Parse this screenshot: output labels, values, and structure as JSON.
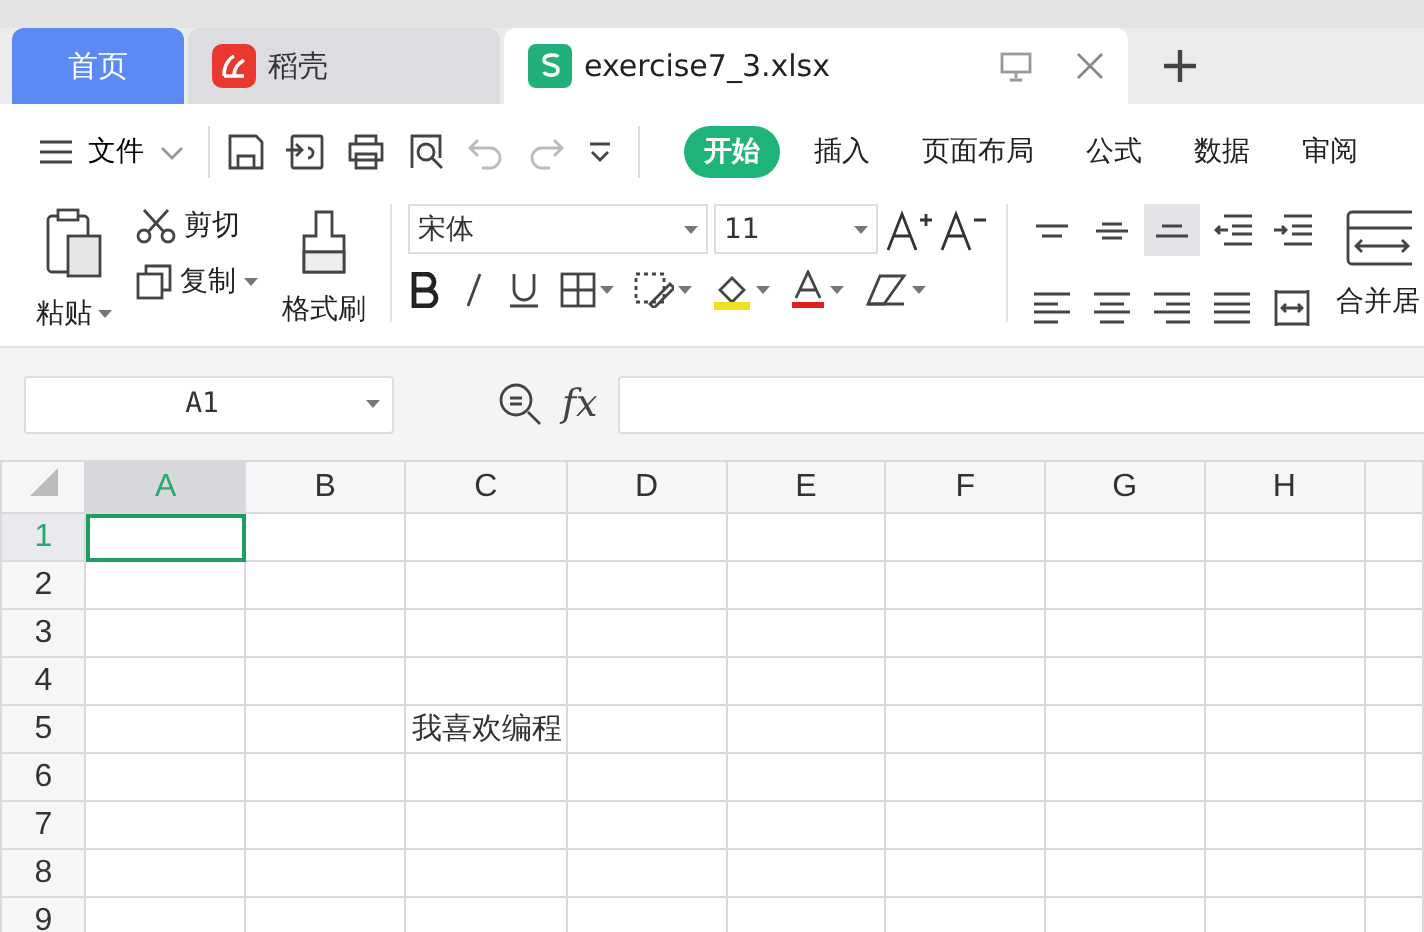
{
  "tabs": [
    {
      "label": "首页",
      "kind": "home",
      "selected": false
    },
    {
      "label": "稻壳",
      "kind": "docer",
      "selected": false
    },
    {
      "label": "exercise7_3.xlsx",
      "kind": "sheet",
      "selected": true
    }
  ],
  "toolbar": {
    "file_menu": "文件",
    "ribbon_tabs": [
      {
        "label": "开始",
        "selected": true
      },
      {
        "label": "插入",
        "selected": false
      },
      {
        "label": "页面布局",
        "selected": false
      },
      {
        "label": "公式",
        "selected": false
      },
      {
        "label": "数据",
        "selected": false
      },
      {
        "label": "审阅",
        "selected": false
      }
    ]
  },
  "ribbon": {
    "paste": "粘贴",
    "cut": "剪切",
    "copy": "复制",
    "format_painter": "格式刷",
    "font": "宋体",
    "font_size": "11",
    "merge": "合并居",
    "alignments": [
      {
        "kind": "top",
        "selected": false
      },
      {
        "kind": "middle",
        "selected": false
      },
      {
        "kind": "bottom",
        "selected": true
      },
      {
        "kind": "outdent",
        "selected": false
      },
      {
        "kind": "indent",
        "selected": false
      },
      {
        "kind": "left",
        "selected": false
      },
      {
        "kind": "center",
        "selected": false
      },
      {
        "kind": "right",
        "selected": false
      },
      {
        "kind": "justify",
        "selected": false
      },
      {
        "kind": "distributed",
        "selected": false
      }
    ]
  },
  "formula_bar": {
    "name_box": "A1",
    "function_label": "fx"
  },
  "sheet": {
    "columns": [
      {
        "label": "A",
        "selected": true
      },
      {
        "label": "B",
        "selected": false
      },
      {
        "label": "C",
        "selected": false
      },
      {
        "label": "D",
        "selected": false
      },
      {
        "label": "E",
        "selected": false
      },
      {
        "label": "F",
        "selected": false
      },
      {
        "label": "G",
        "selected": false
      },
      {
        "label": "H",
        "selected": false
      }
    ],
    "rows": [
      {
        "label": "1",
        "selected": true
      },
      {
        "label": "2",
        "selected": false
      },
      {
        "label": "3",
        "selected": false
      },
      {
        "label": "4",
        "selected": false
      },
      {
        "label": "5",
        "selected": false,
        "cells": [
          null,
          null,
          "我喜欢编程"
        ]
      },
      {
        "label": "6",
        "selected": false
      },
      {
        "label": "7",
        "selected": false
      },
      {
        "label": "8",
        "selected": false
      },
      {
        "label": "9",
        "selected": false
      }
    ]
  }
}
